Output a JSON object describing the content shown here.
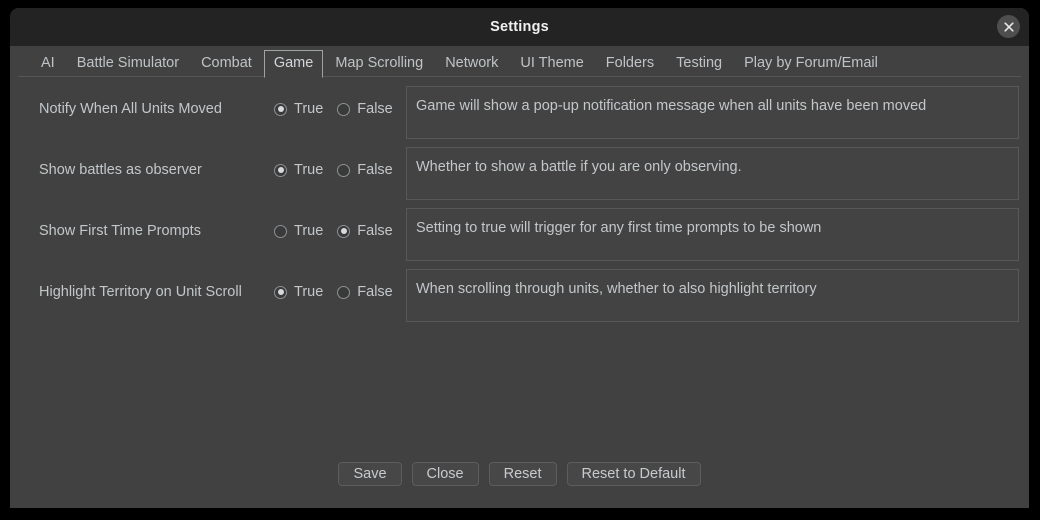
{
  "window": {
    "title": "Settings",
    "close_icon": "close-icon"
  },
  "tabs": [
    {
      "label": "AI",
      "selected": false
    },
    {
      "label": "Battle Simulator",
      "selected": false
    },
    {
      "label": "Combat",
      "selected": false
    },
    {
      "label": "Game",
      "selected": true
    },
    {
      "label": "Map Scrolling",
      "selected": false
    },
    {
      "label": "Network",
      "selected": false
    },
    {
      "label": "UI Theme",
      "selected": false
    },
    {
      "label": "Folders",
      "selected": false
    },
    {
      "label": "Testing",
      "selected": false
    },
    {
      "label": "Play by Forum/Email",
      "selected": false
    }
  ],
  "options": {
    "true_label": "True",
    "false_label": "False"
  },
  "settings": [
    {
      "label": "Notify When All Units Moved",
      "value": "True",
      "description": "Game will show a pop-up notification message when all units have been moved"
    },
    {
      "label": "Show battles as observer",
      "value": "True",
      "description": "Whether to show a battle if you are only observing."
    },
    {
      "label": "Show First Time Prompts",
      "value": "False",
      "description": "Setting to true will trigger for any first time prompts to be shown"
    },
    {
      "label": "Highlight Territory on Unit Scroll",
      "value": "True",
      "description": "When scrolling through units, whether to also highlight territory"
    }
  ],
  "footer_buttons": [
    {
      "label": "Save"
    },
    {
      "label": "Close"
    },
    {
      "label": "Reset"
    },
    {
      "label": "Reset to Default"
    }
  ],
  "colors": {
    "window_background": "#414141",
    "titlebar_background": "#232323",
    "text": "#c3c7ca",
    "title_text": "#f0f0f0",
    "border": "#585858",
    "selected_tab_border": "#9ea3a6"
  }
}
